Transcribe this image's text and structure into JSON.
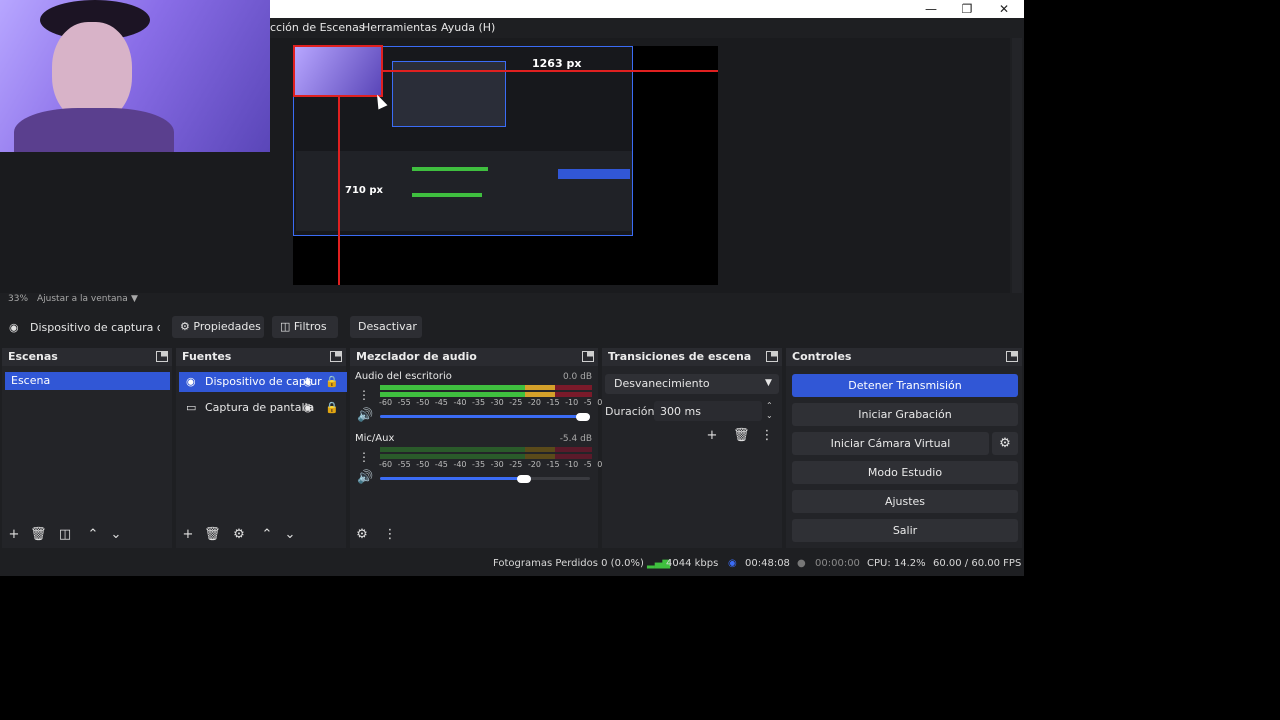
{
  "window": {
    "menus": [
      "cción de Escenas",
      "Herramientas",
      "Ayuda (H)"
    ]
  },
  "preview": {
    "width_label": "1263 px",
    "height_label": "710 px",
    "zoom": "33%",
    "zoom_mode": "Ajustar a la ventana"
  },
  "context_bar": {
    "source_name": "Dispositivo de captura de v",
    "properties": "Propiedades",
    "filters": "Filtros",
    "deactivate": "Desactivar"
  },
  "scenes": {
    "title": "Escenas",
    "items": [
      "Escena"
    ]
  },
  "sources": {
    "title": "Fuentes",
    "items": [
      "Dispositivo de captur",
      "Captura de pantalla"
    ]
  },
  "mixer": {
    "title": "Mezclador de audio",
    "ticks": "-60 -55 -50 -45 -40 -35 -30 -25 -20 -15 -10 -5 0",
    "channels": [
      {
        "name": "Audio del escritorio",
        "db": "0.0 dB",
        "level": 1.0
      },
      {
        "name": "Mic/Aux",
        "db": "-5.4 dB",
        "level": 0.72
      }
    ]
  },
  "transitions": {
    "title": "Transiciones de escena",
    "selected": "Desvanecimiento",
    "duration_label": "Duración",
    "duration_value": "300 ms"
  },
  "controls": {
    "title": "Controles",
    "buttons": [
      "Detener Transmisión",
      "Iniciar Grabación",
      "Iniciar Cámara Virtual",
      "Modo Estudio",
      "Ajustes",
      "Salir"
    ]
  },
  "status": {
    "dropped": "Fotogramas Perdidos 0 (0.0%)",
    "bitrate": "4044 kbps",
    "stream_time": "00:48:08",
    "rec_time": "00:00:00",
    "cpu": "CPU: 14.2%",
    "fps": "60.00 / 60.00 FPS"
  },
  "colors": {
    "accent": "#3157d6",
    "background": "#1e1f22",
    "dock": "#232428"
  }
}
